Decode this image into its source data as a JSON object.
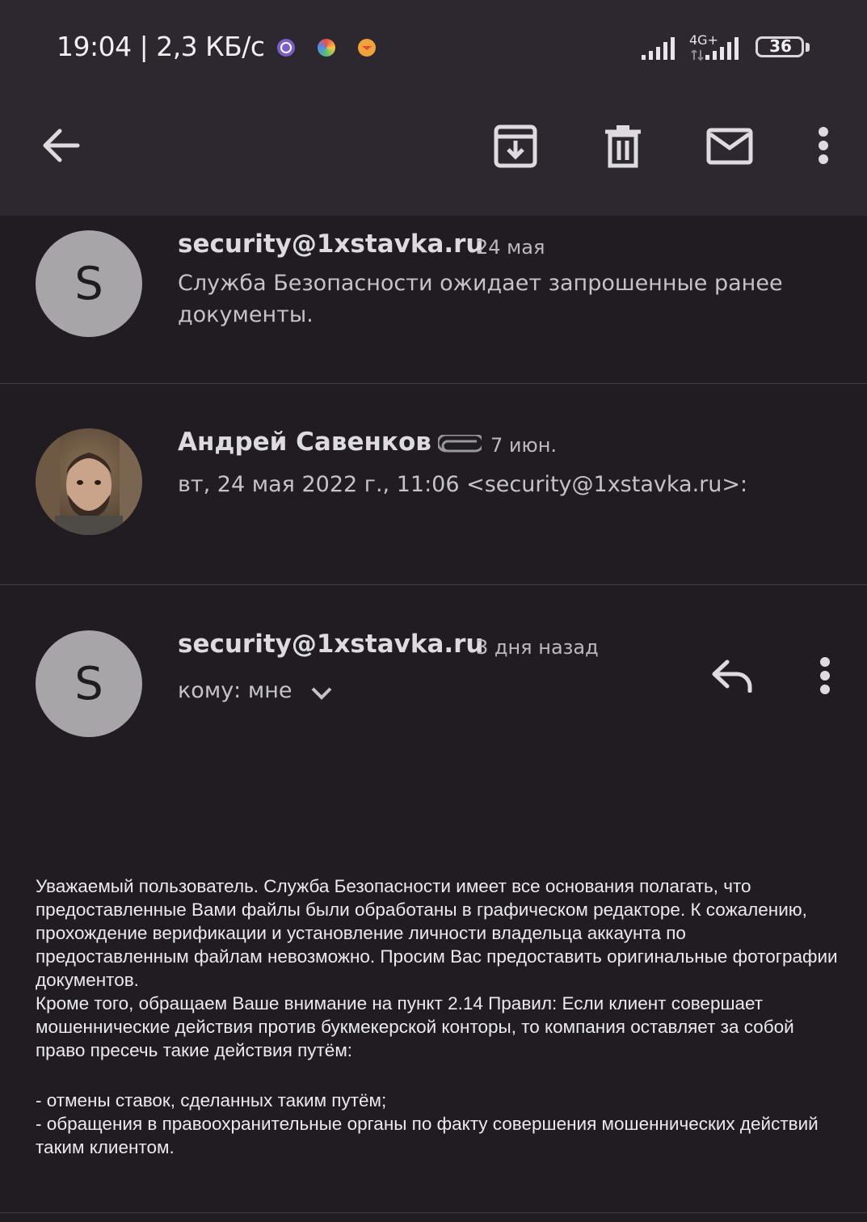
{
  "status_bar": {
    "time_speed": "19:04 | 2,3 КБ/с",
    "network": "4G+",
    "battery": "36",
    "notification_icons": [
      "viber-icon",
      "photos-app-icon",
      "mail-app-icon"
    ]
  },
  "toolbar": {
    "back": "back-arrow-icon",
    "archive": "archive-icon",
    "delete": "trash-icon",
    "mark_unread": "mail-icon",
    "more": "more-vert-icon"
  },
  "messages": [
    {
      "avatar_letter": "S",
      "sender": "security@1xstavka.ru",
      "date": "24 мая",
      "snippet": "Служба Безопасности ожидает запрошенные ранее документы."
    },
    {
      "sender": "Андрей Савенков",
      "date": "7 июн.",
      "has_attachment": true,
      "snippet": "вт, 24 мая 2022 г., 11:06 <security@1xstavka.ru>:"
    },
    {
      "avatar_letter": "S",
      "sender": "security@1xstavka.ru",
      "date": "3 дня назад",
      "recipient": "кому: мне"
    }
  ],
  "email_body": {
    "paragraph1": "Уважаемый пользователь. Служба Безопасности имеет все основания полагать, что предоставленные Вами файлы были обработаны в графическом редакторе. К сожалению, прохождение верификации и установление личности владельца аккаунта по предоставленным файлам невозможно. Просим Вас предоставить оригинальные фотографии документов.",
    "paragraph2": "Кроме того, обращаем Ваше внимание на пункт 2.14 Правил: Если клиент совершает мошеннические действия против букмекерской конторы, то компания оставляет за собой право пресечь такие действия путём:",
    "bullet1": "- отмены ставок, сделанных таким путём;",
    "bullet2": "- обращения в правоохранительные органы по факту совершения мошеннических действий таким клиентом."
  },
  "colors": {
    "background": "#201c22",
    "topbar": "#2d272f",
    "avatar": "#a8a5a9"
  }
}
